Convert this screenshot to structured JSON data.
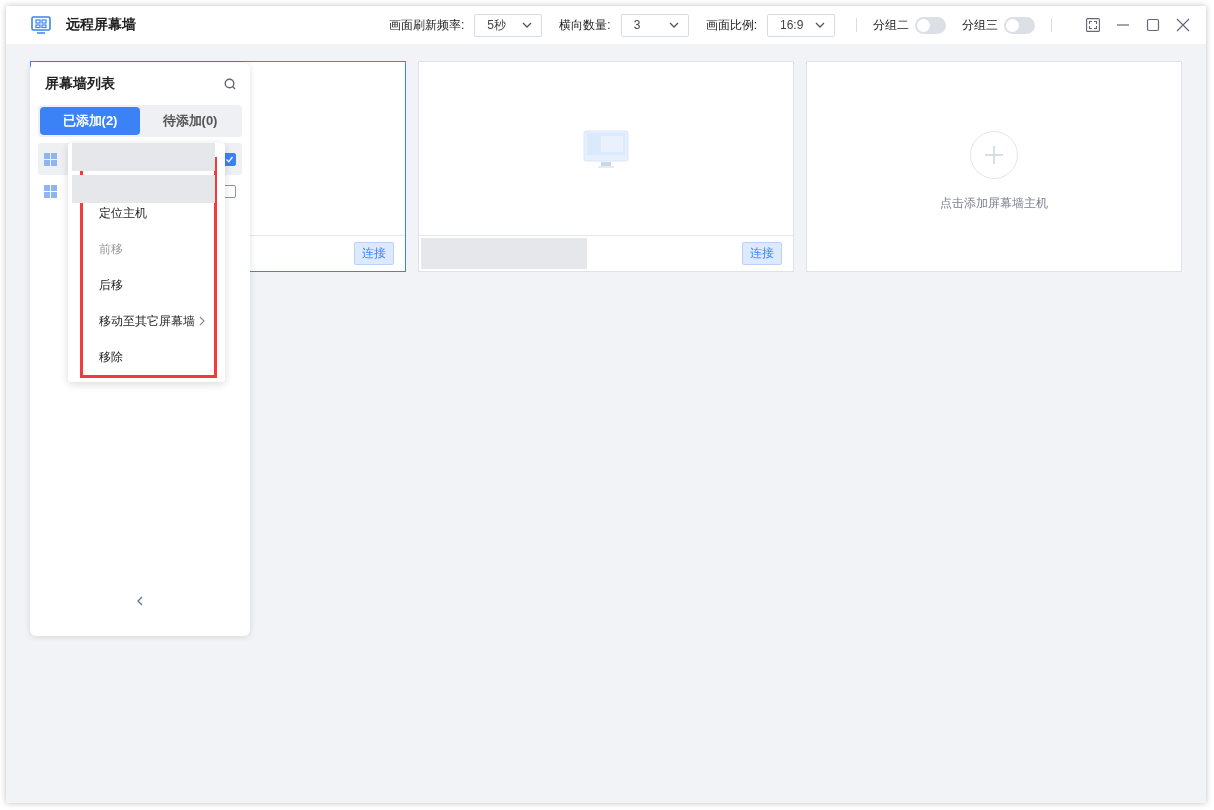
{
  "window": {
    "title": "远程屏幕墙"
  },
  "toolbar": {
    "selects": [
      {
        "label": "画面刷新频率:",
        "value": "5秒"
      },
      {
        "label": "横向数量:",
        "value": "3"
      },
      {
        "label": "画面比例:",
        "value": "16:9"
      }
    ],
    "toggles": [
      {
        "label": "分组二",
        "on": false
      },
      {
        "label": "分组三",
        "on": false
      }
    ]
  },
  "cards": [
    {
      "kind": "host",
      "selected": true,
      "redacted": false,
      "monitor_icon": false,
      "connect": "连接"
    },
    {
      "kind": "host",
      "selected": false,
      "redacted": true,
      "monitor_icon": true,
      "connect": "连接"
    },
    {
      "kind": "add",
      "selected": false,
      "hint": "点击添加屏幕墙主机"
    }
  ],
  "panel": {
    "title": "屏幕墙列表",
    "tabs": [
      {
        "label": "已添加(2)",
        "selected": true
      },
      {
        "label": "待添加(0)",
        "selected": false
      }
    ],
    "items": [
      {
        "checked": true,
        "selected": true
      },
      {
        "checked": false,
        "selected": false
      }
    ]
  },
  "context_menu": {
    "items": [
      {
        "kind": "redacted"
      },
      {
        "kind": "redacted"
      },
      {
        "kind": "item",
        "label": "定位主机",
        "disabled": false,
        "submenu": false
      },
      {
        "kind": "item",
        "label": "前移",
        "disabled": true,
        "submenu": false
      },
      {
        "kind": "item",
        "label": "后移",
        "disabled": false,
        "submenu": false
      },
      {
        "kind": "item",
        "label": "移动至其它屏幕墙",
        "disabled": false,
        "submenu": true
      },
      {
        "kind": "item",
        "label": "移除",
        "disabled": false,
        "submenu": false
      }
    ]
  }
}
